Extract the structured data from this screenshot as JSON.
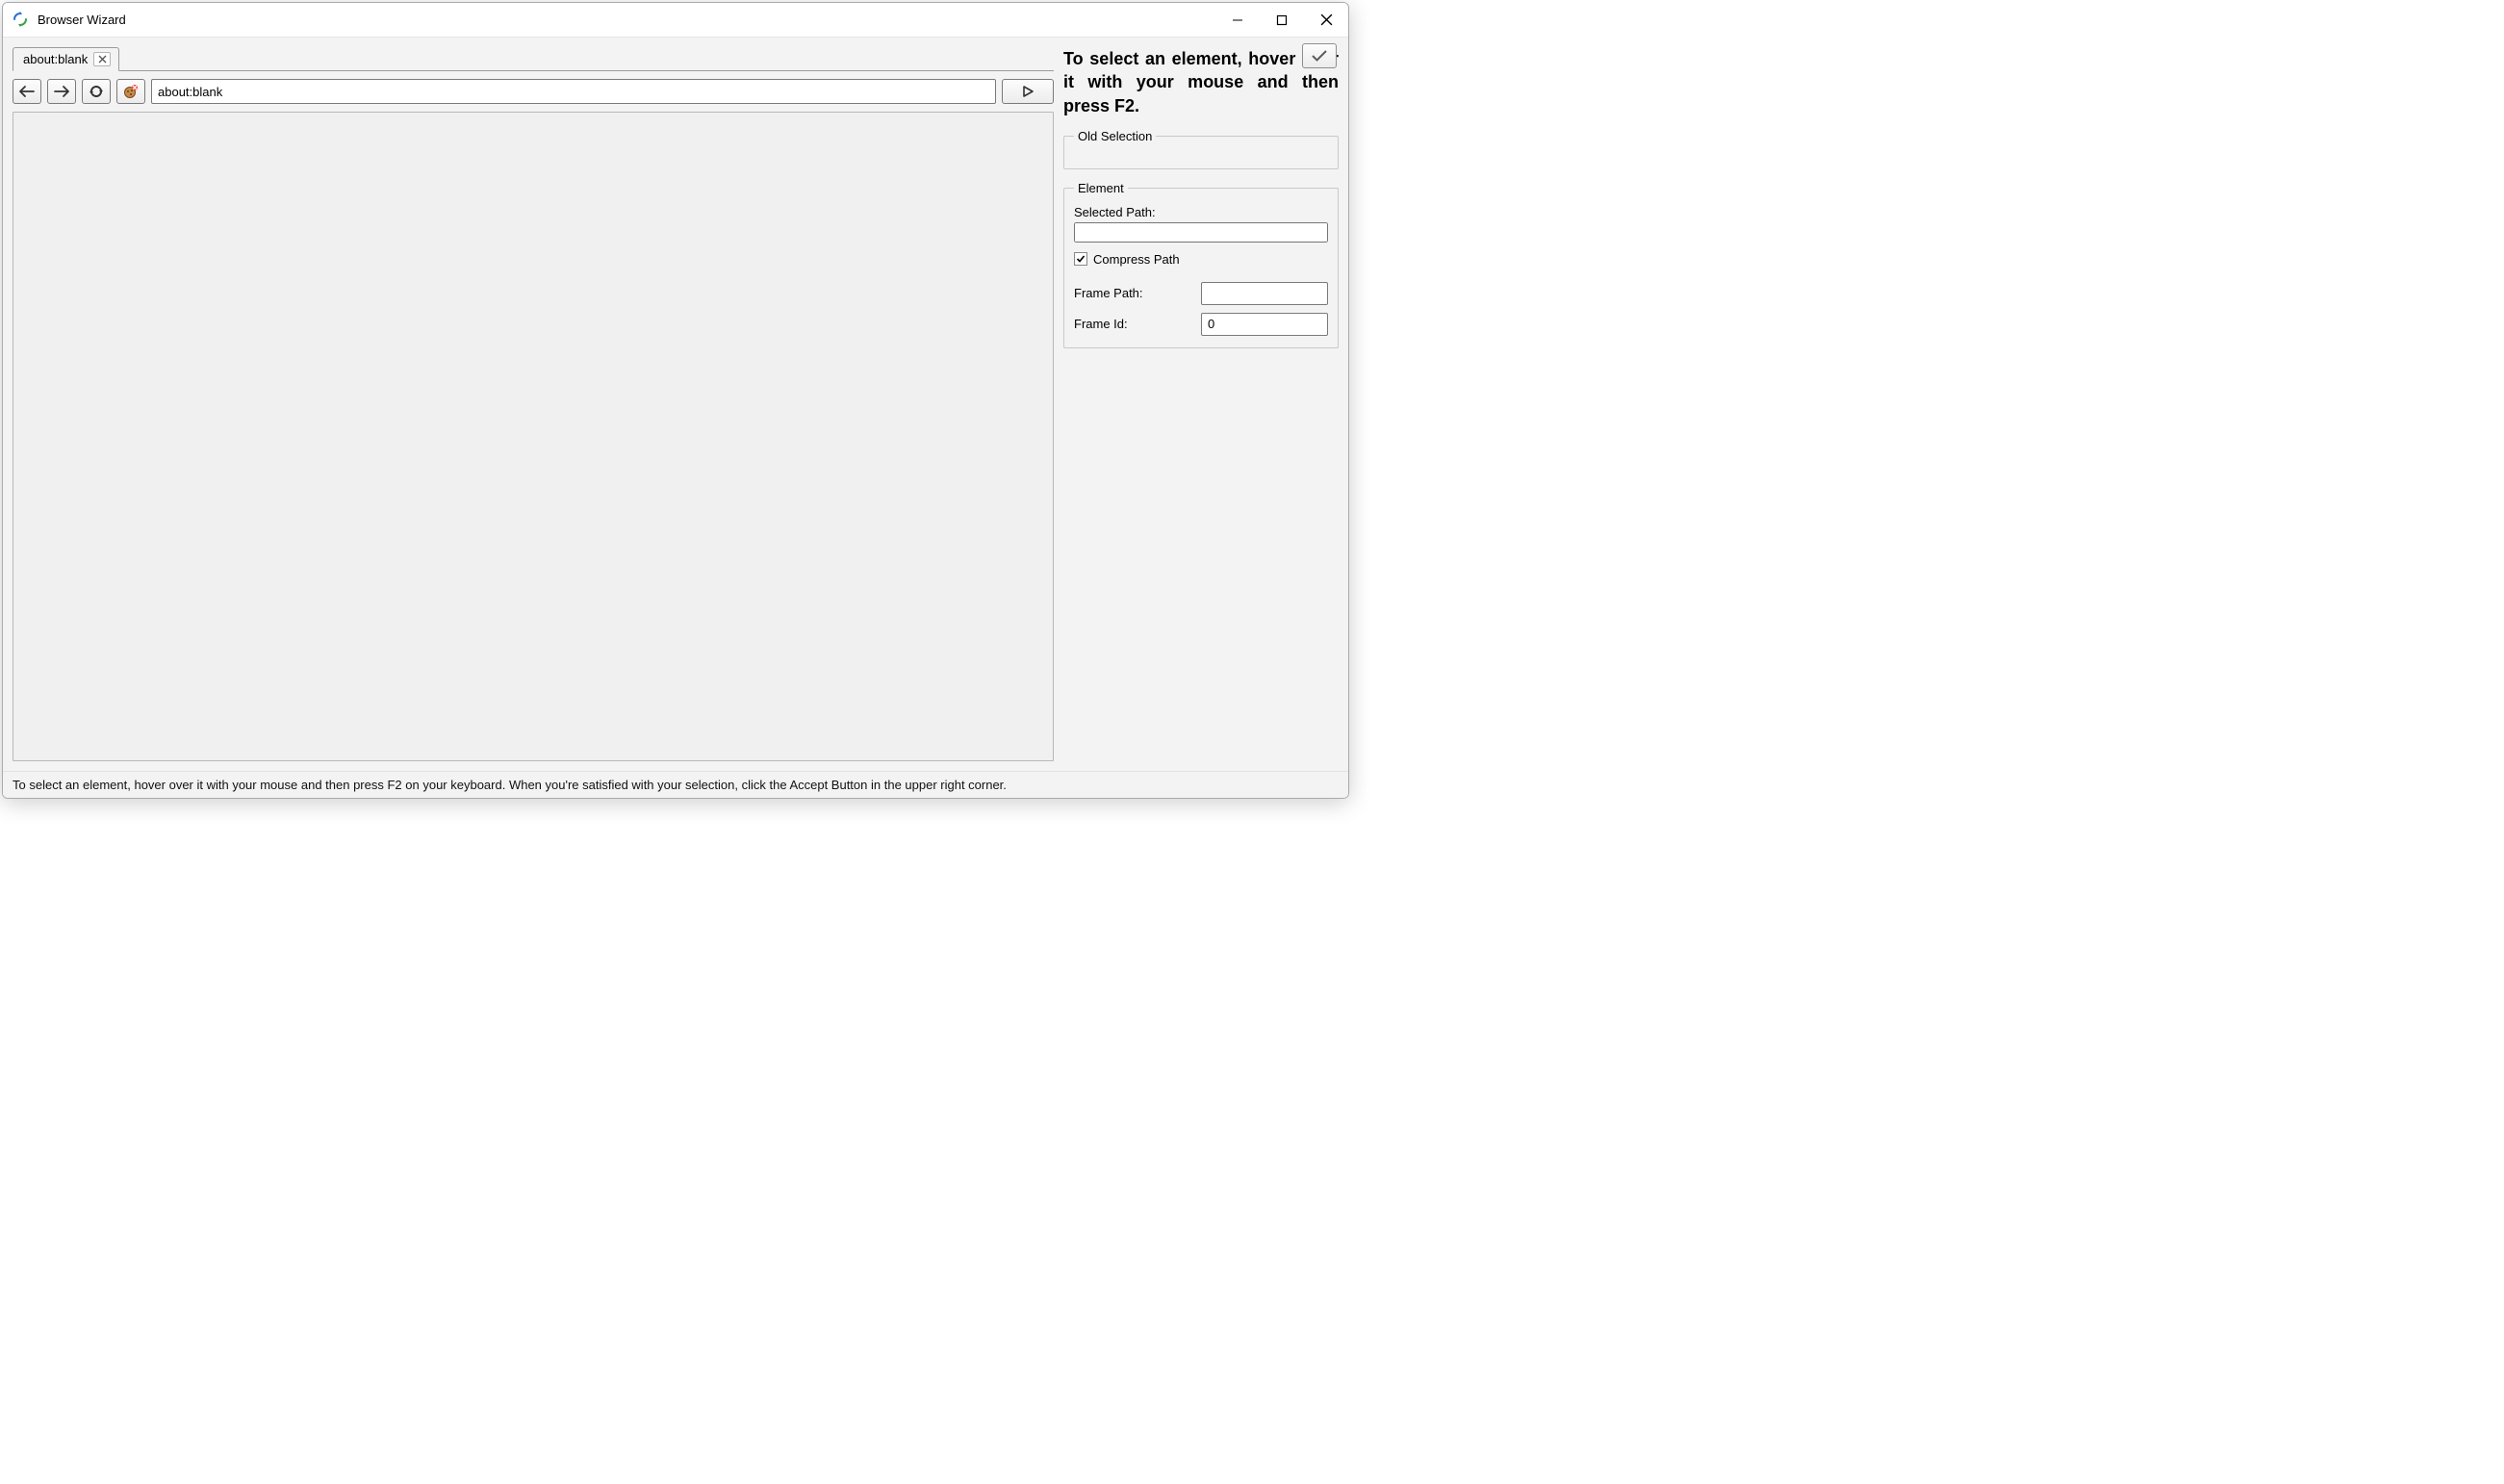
{
  "window": {
    "title": "Browser Wizard"
  },
  "tabs": [
    {
      "label": "about:blank"
    }
  ],
  "addressbar": {
    "value": "about:blank"
  },
  "sidepanel": {
    "instructions": "To select an element, hover over it with your mouse and then press F2.",
    "groups": {
      "old_selection": {
        "legend": "Old Selection"
      },
      "element": {
        "legend": "Element",
        "selected_path_label": "Selected Path:",
        "selected_path_value": "",
        "compress_path_label": "Compress Path",
        "compress_path_checked": true,
        "frame_path_label": "Frame Path:",
        "frame_path_value": "",
        "frame_id_label": "Frame Id:",
        "frame_id_value": "0"
      }
    }
  },
  "statusbar": {
    "text": "To select an element, hover over it with your mouse and then press F2 on your keyboard. When you're satisfied with your selection, click the Accept Button in the upper right corner."
  }
}
